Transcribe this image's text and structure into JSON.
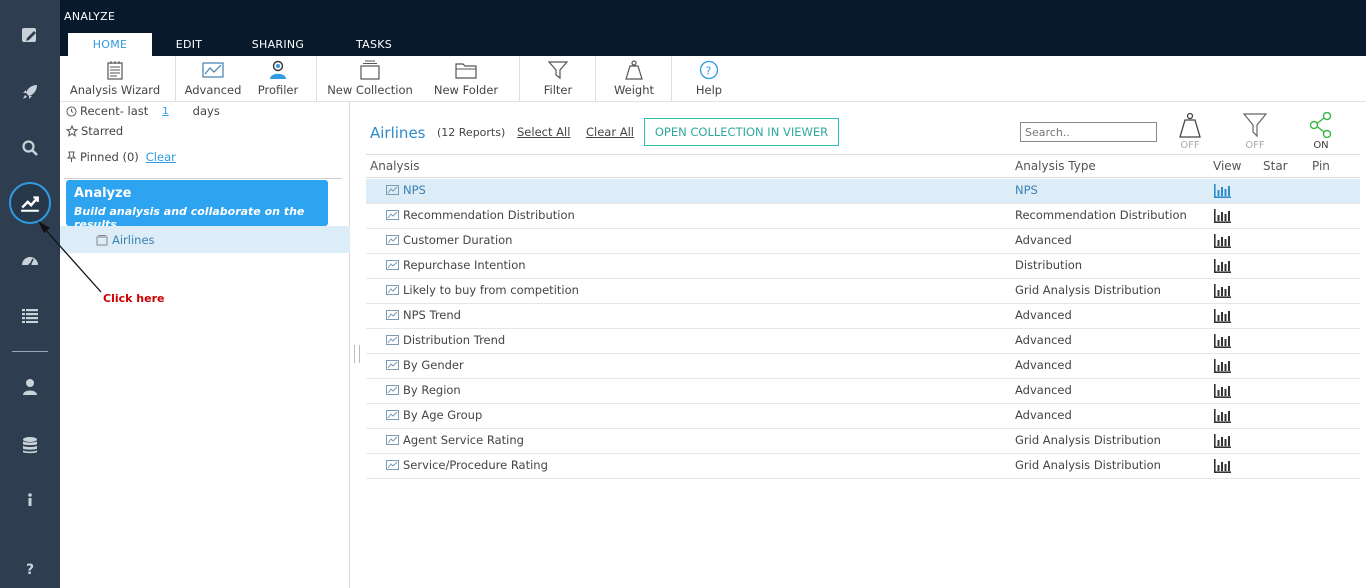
{
  "app": {
    "title": "ANALYZE"
  },
  "tabs": [
    {
      "label": "HOME",
      "active": true
    },
    {
      "label": "EDIT",
      "active": false
    },
    {
      "label": "SHARING",
      "active": false
    },
    {
      "label": "TASKS",
      "active": false
    }
  ],
  "ribbon": {
    "analysis_wizard": "Analysis Wizard",
    "advanced": "Advanced",
    "profiler": "Profiler",
    "new_collection": "New Collection",
    "new_folder": "New Folder",
    "filter": "Filter",
    "weight": "Weight",
    "help": "Help"
  },
  "left_panel": {
    "recent_label": "Recent- last",
    "recent_value": "1",
    "recent_unit": "days",
    "starred": "Starred",
    "pinned": "Pinned (0)",
    "clear": "Clear",
    "card_title": "Analyze",
    "card_subtitle": "Build analysis and collaborate on the results",
    "collection": "Airlines",
    "annotation": "Click here"
  },
  "main": {
    "collection_title": "Airlines",
    "report_count": "(12 Reports)",
    "select_all": "Select All",
    "clear_all": "Clear All",
    "open_button": "OPEN COLLECTION IN VIEWER",
    "search_placeholder": "Search..",
    "weight_toggle": "OFF",
    "filter_toggle": "OFF",
    "share_toggle": "ON",
    "columns": {
      "analysis": "Analysis",
      "type": "Analysis Type",
      "view": "View",
      "star": "Star",
      "pin": "Pin"
    },
    "rows": [
      {
        "name": "NPS",
        "type": "NPS",
        "selected": true
      },
      {
        "name": "Recommendation Distribution",
        "type": "Recommendation Distribution"
      },
      {
        "name": "Customer Duration",
        "type": "Advanced"
      },
      {
        "name": "Repurchase Intention",
        "type": "Distribution"
      },
      {
        "name": "Likely to buy from competition",
        "type": "Grid Analysis Distribution"
      },
      {
        "name": "NPS Trend",
        "type": "Advanced"
      },
      {
        "name": "Distribution Trend",
        "type": "Advanced"
      },
      {
        "name": "By Gender",
        "type": "Advanced"
      },
      {
        "name": "By Region",
        "type": "Advanced"
      },
      {
        "name": "By Age Group",
        "type": "Advanced"
      },
      {
        "name": "Agent Service Rating",
        "type": "Grid Analysis Distribution"
      },
      {
        "name": "Service/Procedure Rating",
        "type": "Grid Analysis Distribution"
      }
    ]
  },
  "colors": {
    "rail": "#2e3e50",
    "topbar": "#07192b",
    "accent": "#2f9be0",
    "annotation": "#cc0000",
    "toggle_on": "#3bb54a"
  },
  "icons": [
    "edit-icon",
    "rocket-icon",
    "search-icon",
    "analyze-chart-icon",
    "dashboard-icon",
    "list-icon",
    "user-icon",
    "database-icon",
    "info-icon",
    "help-icon"
  ]
}
